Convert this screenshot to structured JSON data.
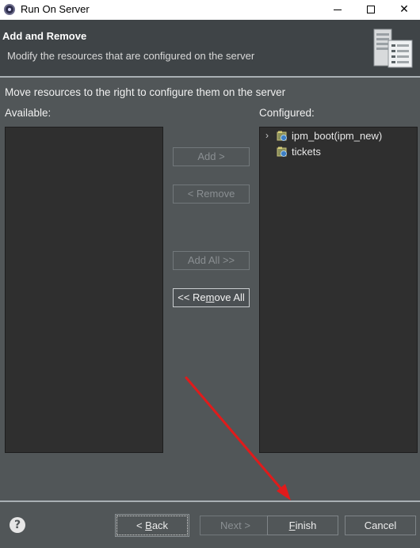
{
  "window": {
    "title": "Run On Server",
    "controls": {
      "minimize": "minimize",
      "maximize": "maximize",
      "close": "✕"
    }
  },
  "header": {
    "title": "Add and Remove",
    "description": "Modify the resources that are configured on the server"
  },
  "body": {
    "instruction": "Move resources to the right to configure them on the server",
    "available_label": "Available:",
    "configured_label": "Configured:",
    "available_items": [],
    "configured_items": [
      {
        "label": "ipm_boot(ipm_new)",
        "expandable": true,
        "expand_glyph": "›"
      },
      {
        "label": "tickets",
        "expandable": false
      }
    ]
  },
  "actions": {
    "add": {
      "label": "Add >",
      "enabled": false
    },
    "remove": {
      "label": "< Remove",
      "enabled": false
    },
    "add_all": {
      "label": "Add All >>",
      "enabled": false
    },
    "remove_all": {
      "pre": "<< Re",
      "mnemonic": "m",
      "post": "ove All",
      "enabled": true
    }
  },
  "footer": {
    "help_glyph": "?",
    "back": {
      "pre": "< ",
      "mnemonic": "B",
      "post": "ack",
      "enabled": true
    },
    "next": {
      "label": "Next >",
      "enabled": false
    },
    "finish": {
      "mnemonic": "F",
      "post": "inish",
      "enabled": true
    },
    "cancel": {
      "label": "Cancel",
      "enabled": true
    }
  },
  "annotation": {
    "arrow_color": "#e01b1b"
  },
  "colors": {
    "background": "#515658",
    "header_bg": "#3f4447",
    "list_bg": "#2f2f2f",
    "divider": "#a9b0b4"
  }
}
